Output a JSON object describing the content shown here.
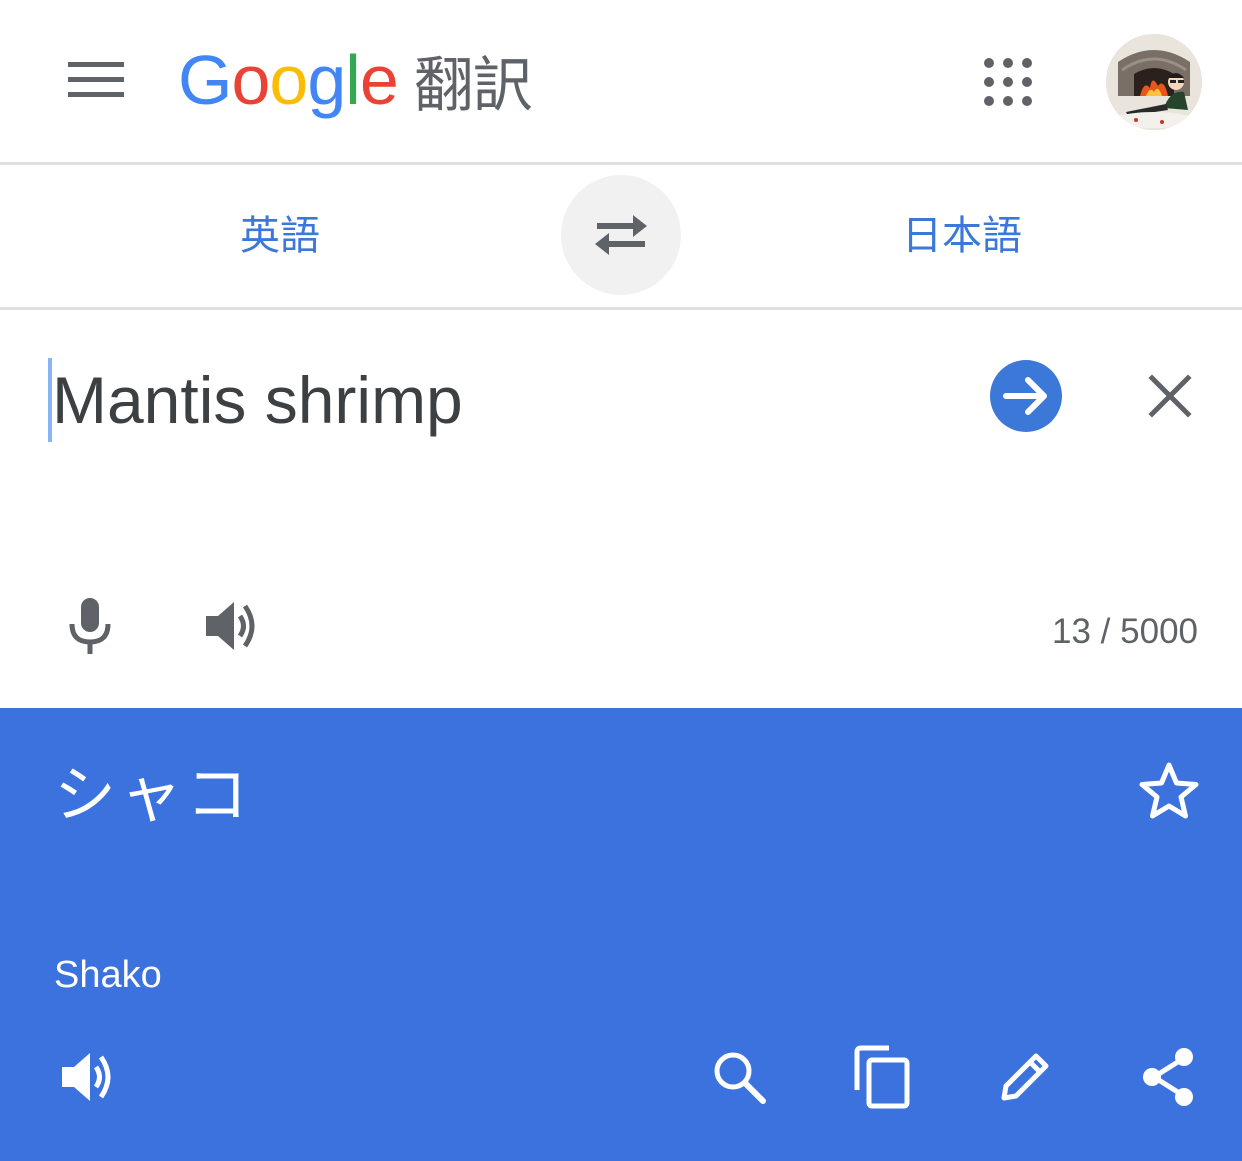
{
  "header": {
    "logo": {
      "letters": [
        "G",
        "o",
        "o",
        "g",
        "l",
        "e"
      ],
      "suffix": "翻訳"
    },
    "menu_icon": "hamburger-menu-icon",
    "apps_icon": "apps-grid-icon",
    "avatar_icon": "user-avatar"
  },
  "languages": {
    "source": "英語",
    "target": "日本語",
    "swap_icon": "swap-arrows-icon"
  },
  "input": {
    "text": "Mantis shrimp",
    "char_count": "13 / 5000"
  },
  "result": {
    "text": "シャコ",
    "romanization": "Shako"
  },
  "colors": {
    "accent": "#3c78d8",
    "result_background": "#3b72de",
    "logo_blue": "#4285f4",
    "logo_red": "#ea4335",
    "logo_yellow": "#fbbc05",
    "logo_green": "#34a853"
  }
}
